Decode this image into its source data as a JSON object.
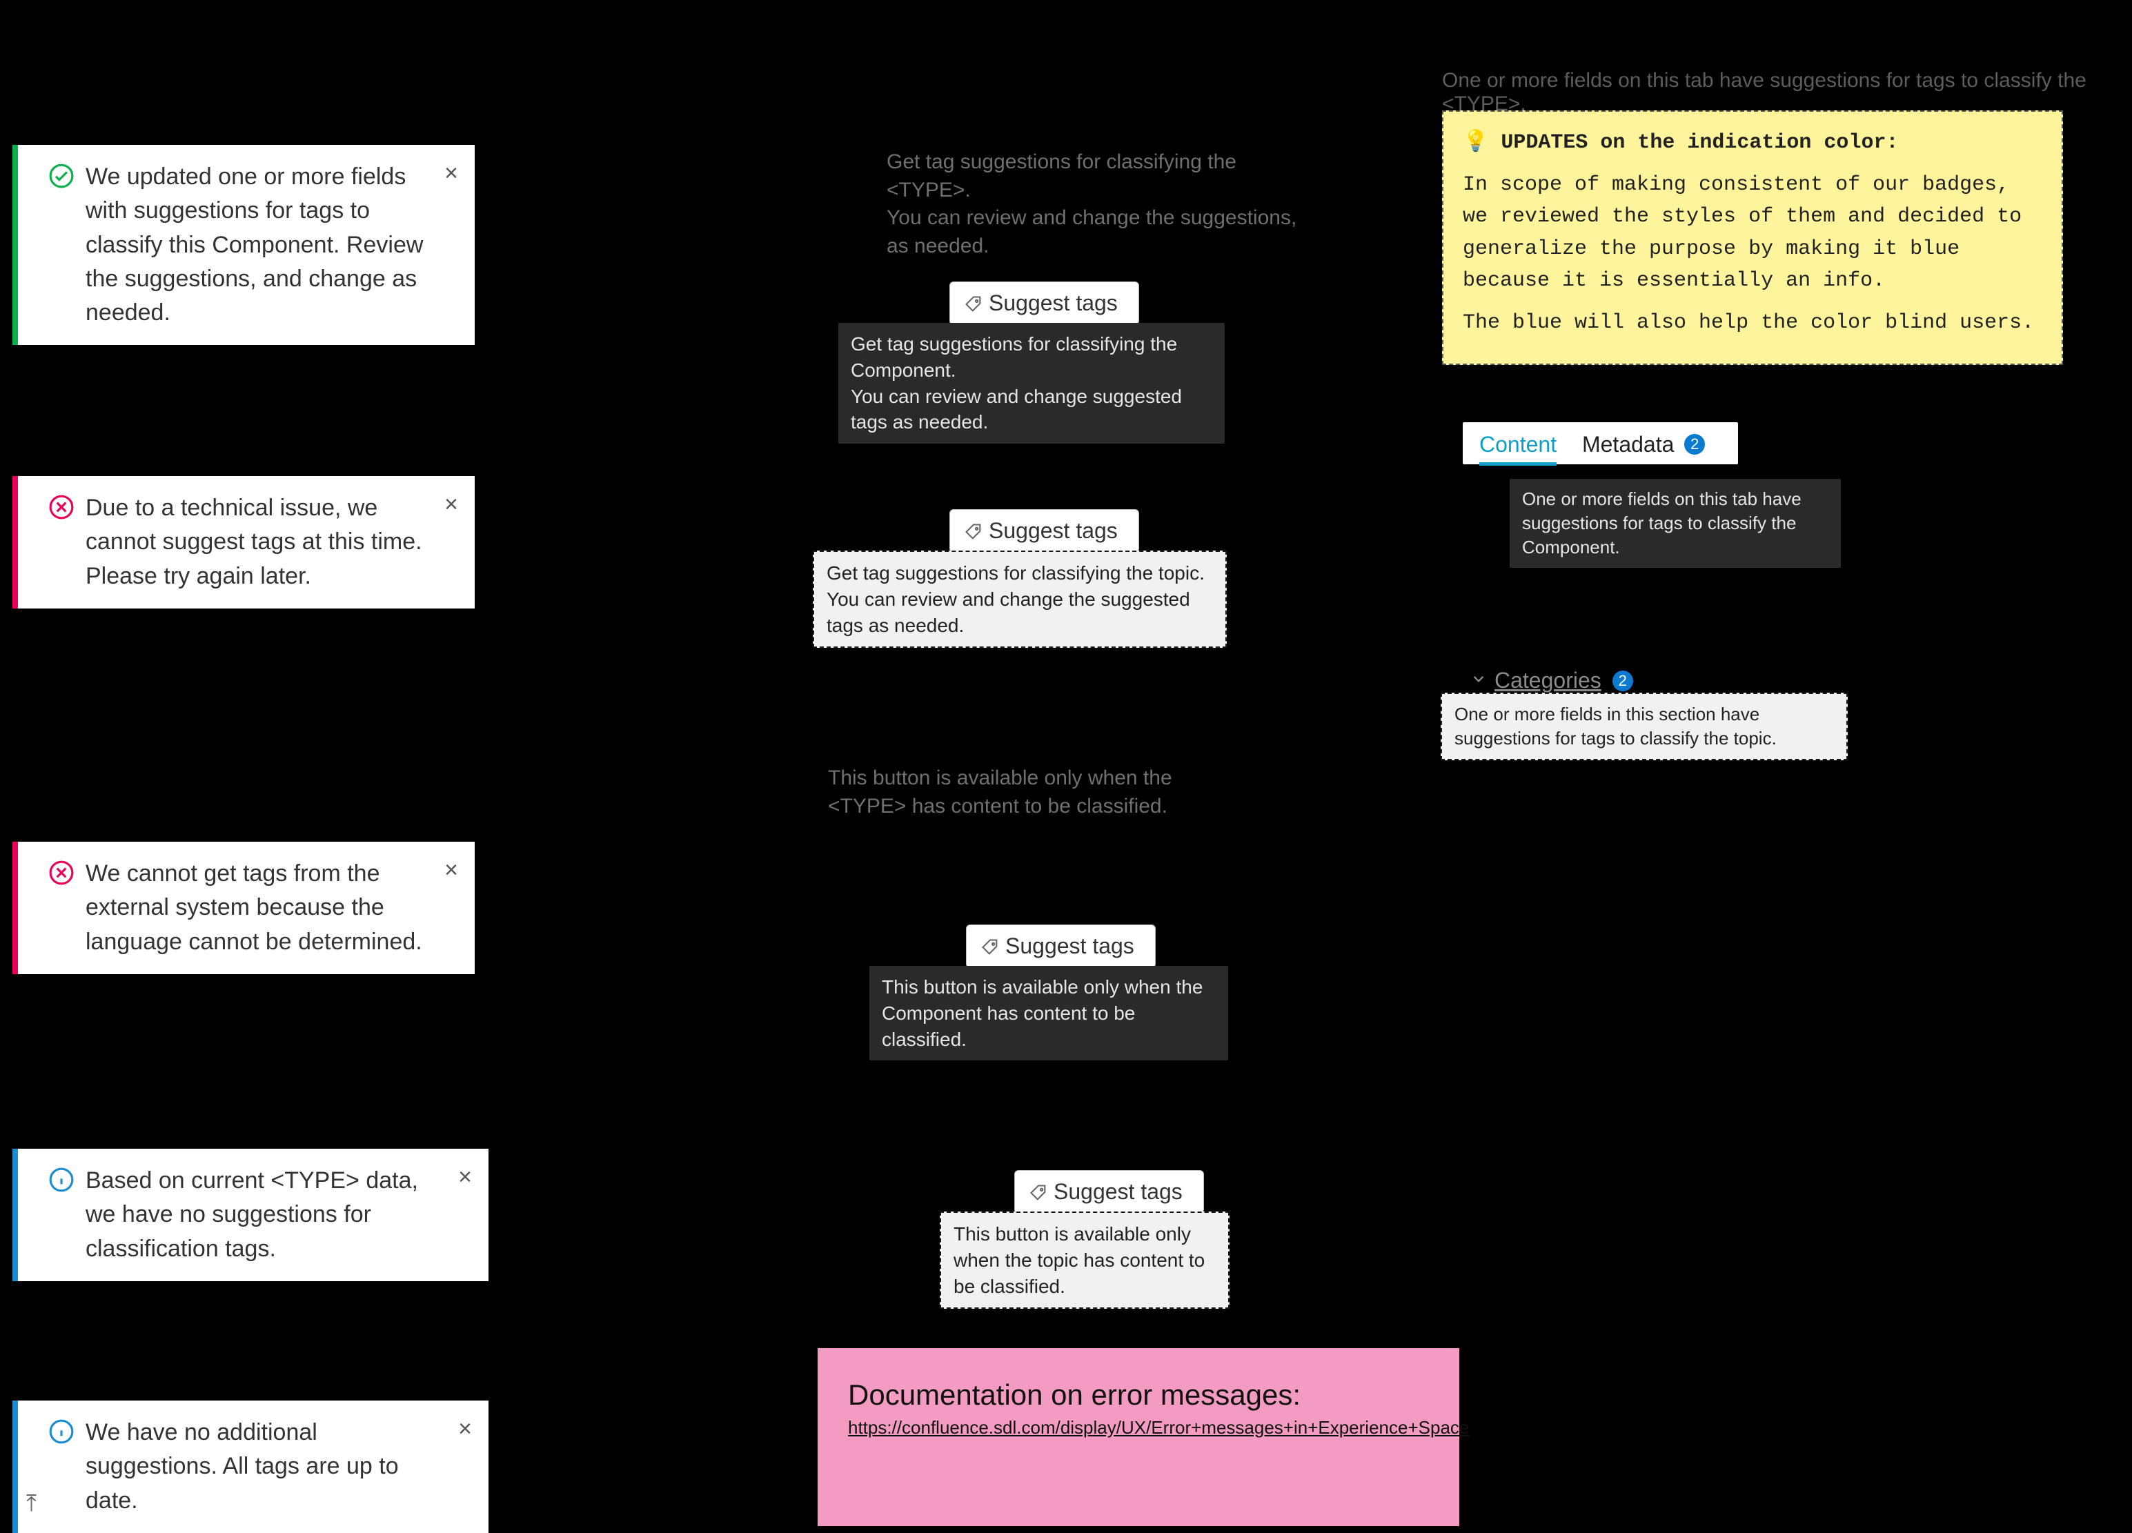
{
  "close_glyph": "×",
  "toasts": {
    "t1": {
      "text": "We updated one or more fields with suggestions for tags to classify this Component. Review the suggestions, and change as needed."
    },
    "t2": {
      "text": "Due to a technical issue, we cannot suggest tags at this time. Please try again later."
    },
    "t3": {
      "text": "We cannot get tags from the external system because the language cannot be determined."
    },
    "t4": {
      "text": "Based on current <TYPE> data, we have no suggestions for classification tags."
    },
    "t5": {
      "text": "We have no additional suggestions. All tags are up to date."
    }
  },
  "suggest_button_label": "Suggest tags",
  "center_labels": {
    "l1": "Get tag suggestions for classifying the <TYPE>.\nYou can review and change the suggestions, as needed.",
    "l2": "This button is available only when the <TYPE> has content to be classified."
  },
  "tips": {
    "tip1": "Get tag suggestions for classifying the Component.\nYou can review and change suggested tags as needed.",
    "tip2": "Get tag suggestions for classifying the topic.\nYou can review and change the suggested tags as needed.",
    "tip3": "This button is available only when the Component has content to be classified.",
    "tip4": "This button is available only when the topic has content to be classified."
  },
  "ghost_header": "One or more fields on this tab have suggestions for tags to classify the <TYPE>.",
  "sticky": {
    "title": "💡 UPDATES on the indication color:",
    "p1": "In scope of making consistent of our badges, we reviewed the styles of them and decided to generalize the purpose by making it blue because it is essentially an info.",
    "p2": "The blue will also help the color blind users."
  },
  "tabs": {
    "content_label": "Content",
    "metadata_label": "Metadata",
    "metadata_badge": "2",
    "tip": "One or more fields on this tab have suggestions for tags to classify the Component."
  },
  "categories": {
    "label": "Categories",
    "badge": "2",
    "tip": "One or more fields in this section have suggestions for tags to classify the topic."
  },
  "pink": {
    "title": "Documentation on error messages:",
    "link_text": "https://confluence.sdl.com/display/UX/Error+messages+in+Experience+Space"
  }
}
